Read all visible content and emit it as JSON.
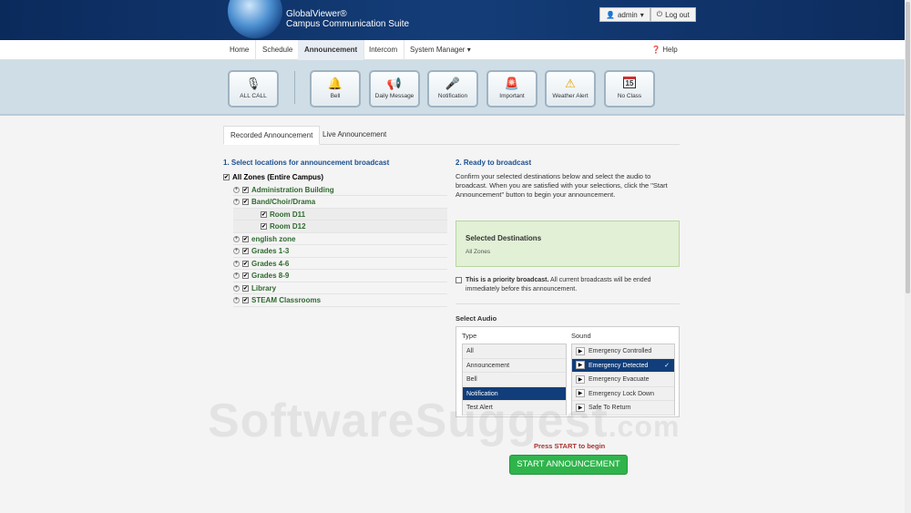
{
  "header": {
    "brand_line1": "GlobalViewer®",
    "brand_line2": "Campus Communication Suite",
    "user": "admin",
    "logout": "Log out"
  },
  "nav": {
    "items": [
      "Home",
      "Schedule",
      "Announcement",
      "Intercom",
      "System Manager"
    ],
    "help": "Help"
  },
  "toolbar": {
    "buttons": [
      {
        "label": "ALL CALL",
        "icon": "microphone-icon"
      },
      {
        "label": "Bell",
        "icon": "bell-icon"
      },
      {
        "label": "Daily Message",
        "icon": "megaphone-icon"
      },
      {
        "label": "Notification",
        "icon": "handheld-mic-icon"
      },
      {
        "label": "Important",
        "icon": "siren-icon"
      },
      {
        "label": "Weather Alert",
        "icon": "warning-icon"
      },
      {
        "label": "No Class",
        "icon": "calendar-icon"
      }
    ],
    "calendar_day": "15"
  },
  "tabs": [
    "Recorded Announcement",
    "Live Announcement"
  ],
  "left": {
    "heading": "1. Select locations for announcement broadcast",
    "root": "All Zones (Entire Campus)",
    "zones": [
      "Administration Building",
      "Band/Choir/Drama",
      "english zone",
      "Grades 1-3",
      "Grades 4-6",
      "Grades 8-9",
      "Library",
      "STEAM Classrooms"
    ],
    "subzones": [
      "Room D11",
      "Room D12"
    ]
  },
  "right": {
    "heading": "2. Ready to broadcast",
    "instructions": "Confirm your selected destinations below and select the audio to broadcast. When you are satisfied with your selections, click the \"Start Announcement\" button to begin your announcement.",
    "selected_title": "Selected Destinations",
    "selected_value": "All Zones",
    "priority_bold": "This is a priority broadcast.",
    "priority_rest": " All current broadcasts will be ended immediately before this announcement.",
    "select_audio": "Select Audio",
    "type_header": "Type",
    "sound_header": "Sound",
    "types": [
      "All",
      "Announcement",
      "Bell",
      "Notification",
      "Test Alert"
    ],
    "selected_type": "Notification",
    "sounds": [
      "Emergency Controlled",
      "Emergency Detected",
      "Emergency Evacuate",
      "Emergency Lock Down",
      "Safe To Return"
    ],
    "selected_sound": "Emergency Detected",
    "press_start_pre": "Press ",
    "press_start_bold": "START",
    "press_start_post": " to begin",
    "start_button": "START ANNOUNCEMENT"
  },
  "watermark": {
    "main": "SoftwareSuggest",
    "suffix": ".com"
  }
}
